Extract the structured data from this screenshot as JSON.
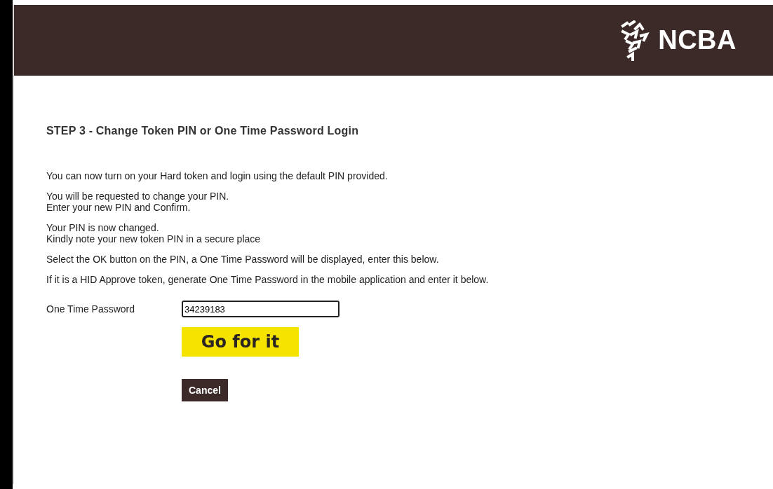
{
  "header": {
    "logo_text": "NCBA"
  },
  "step_title": "STEP 3 - Change Token PIN or One Time Password Login",
  "paragraphs": [
    "You can now turn on your Hard token and login using the default PIN provided.",
    "You will be requested to change your PIN.\nEnter your new PIN and Confirm.",
    "Your PIN is now changed.\nKindly note your new token PIN in a secure place",
    "Select the OK button on the PIN, a One Time Password will be displayed, enter this below.",
    "If it is a HID Approve token, generate One Time Password in the mobile application and enter it below."
  ],
  "form": {
    "label": "One Time Password",
    "value": "34239183",
    "submit_button": "Go for it",
    "cancel_button": "Cancel"
  }
}
